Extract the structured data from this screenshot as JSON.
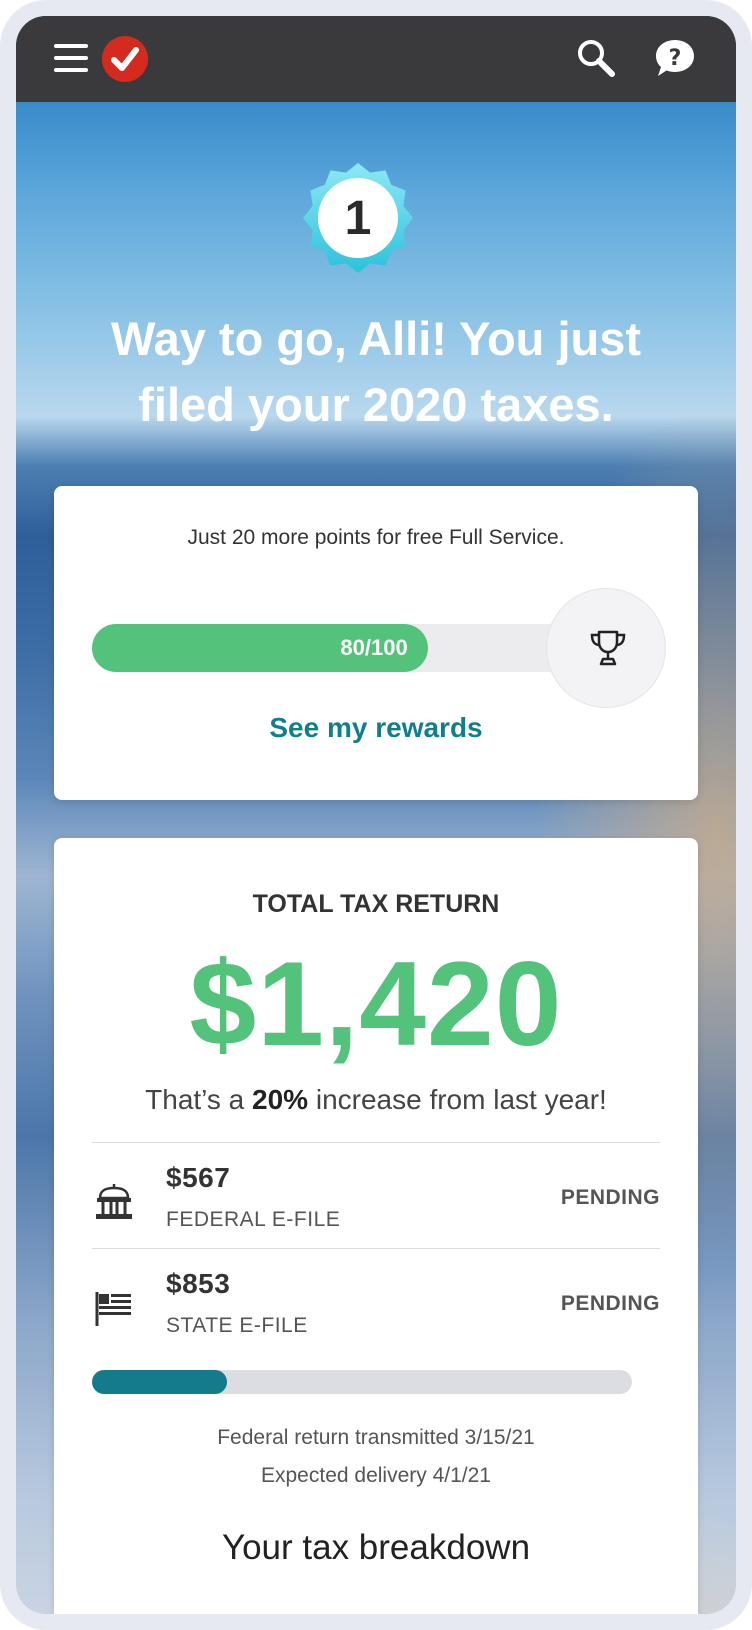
{
  "header": {
    "menu_icon": "hamburger-menu-icon",
    "logo_icon": "checkmark-logo-icon",
    "search_icon": "search-icon",
    "help_icon": "help-bubble-icon",
    "background_color": "#3a3a3c",
    "logo_color": "#d52b1e"
  },
  "hero": {
    "badge_number": "1",
    "headline_line1": "Way to go, Alli! You just",
    "headline_line2": "filed your 2020 taxes."
  },
  "rewards": {
    "message": "Just 20 more points for free Full Service.",
    "progress_label": "80/100",
    "progress_fraction": 0.8,
    "trophy_icon": "trophy-icon",
    "link_label": "See my rewards",
    "progress_color": "#53c27a",
    "link_color": "#0f7f8b"
  },
  "return": {
    "total_label": "TOTAL TAX RETURN",
    "total_amount": "$1,420",
    "increase_prefix": "That’s a",
    "increase_value": "20%",
    "increase_suffix": "increase from last year!",
    "amount_color": "#53c27a",
    "items": [
      {
        "icon": "government-building-icon",
        "amount": "$567",
        "label": "FEDERAL E-FILE",
        "status": "PENDING"
      },
      {
        "icon": "state-flag-icon",
        "amount": "$853",
        "label": "STATE E-FILE",
        "status": "PENDING"
      }
    ],
    "status_progress_fraction": 0.25,
    "status_color": "#137b8c",
    "transmitted_text": "Federal return transmitted 3/15/21",
    "delivery_text": "Expected delivery 4/1/21",
    "breakdown_title": "Your tax breakdown"
  }
}
